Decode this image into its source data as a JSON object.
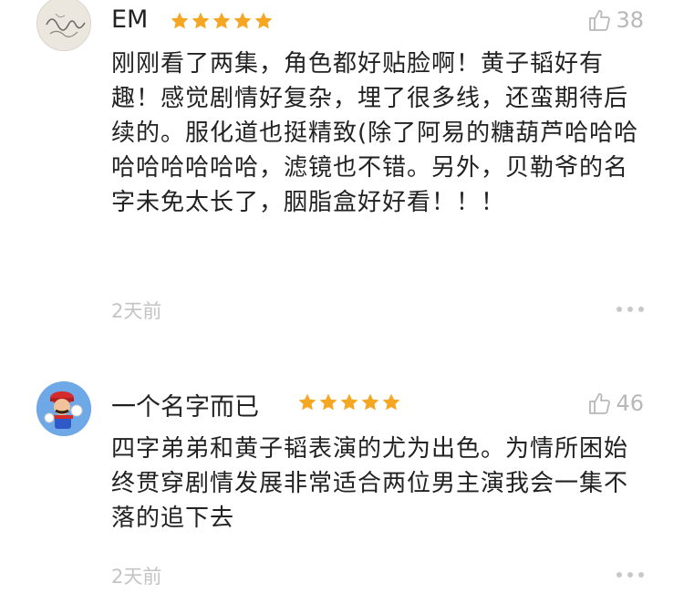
{
  "colors": {
    "star": "#f5a623",
    "muted": "#c4c4c4",
    "text": "#222222"
  },
  "comments": [
    {
      "username": "EM",
      "rating": 5,
      "likes": "38",
      "text": "刚刚看了两集，角色都好贴脸啊！黄子韬好有趣！感觉剧情好复杂，埋了很多线，还蛮期待后续的。服化道也挺精致(除了阿易的糖葫芦哈哈哈哈哈哈哈哈哈，滤镜也不错。另外，贝勒爷的名字未免太长了，胭脂盒好好看！！！",
      "time": "2天前",
      "avatar_icon": "signature-avatar-icon"
    },
    {
      "username": "一个名字而已",
      "rating": 5,
      "likes": "46",
      "text": "四字弟弟和黄子韬表演的尤为出色。为情所困始终贯穿剧情发展非常适合两位男主演我会一集不落的追下去",
      "time": "2天前",
      "avatar_icon": "mario-avatar-icon"
    }
  ]
}
